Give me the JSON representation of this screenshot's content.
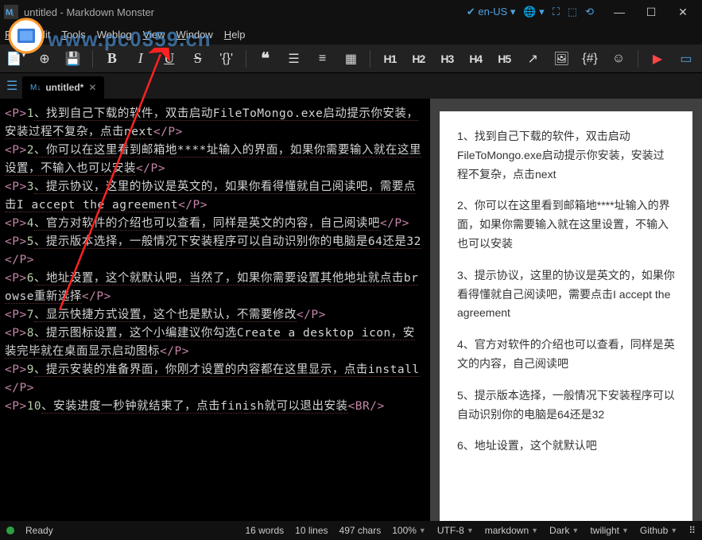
{
  "title": "untitled  - Markdown Monster",
  "lang": "en-US",
  "menu": [
    "File",
    "Edit",
    "Tools",
    "Weblog",
    "View",
    "Window",
    "Help"
  ],
  "toolbar_headings": [
    "H1",
    "H2",
    "H3",
    "H4",
    "H5"
  ],
  "tab": {
    "name": "untitled*",
    "icon": "⬇"
  },
  "editor_lines": [
    {
      "n": "1",
      "t": "、找到自己下载的软件，双击启动FileToMongo.exe启动提示你安装，安装过程不复杂，点击next"
    },
    {
      "n": "2",
      "t": "、你可以在这里看到邮箱地****址输入的界面，如果你需要输入就在这里设置，不输入也可以安装"
    },
    {
      "n": "3",
      "t": "、提示协议，这里的协议是英文的，如果你看得懂就自己阅读吧，需要点击I accept the agreement"
    },
    {
      "n": "4",
      "t": "、官方对软件的介绍也可以查看，同样是英文的内容，自己阅读吧"
    },
    {
      "n": "5",
      "t": "、提示版本选择，一般情况下安装程序可以自动识别你的电脑是64还是32"
    },
    {
      "n": "6",
      "t": "、地址设置，这个就默认吧，当然了，如果你需要设置其他地址就点击browse重新选择"
    },
    {
      "n": "7",
      "t": "、显示快捷方式设置，这个也是默认，不需要修改"
    },
    {
      "n": "8",
      "t": "、提示图标设置，这个小编建议你勾选Create a desktop icon，安装完毕就在桌面显示启动图标"
    },
    {
      "n": "9",
      "t": "、提示安装的准备界面，你刚才设置的内容都在这里显示，点击install"
    },
    {
      "n": "10",
      "t": "、安装进度一秒钟就结束了，点击finish就可以退出安装"
    }
  ],
  "preview_paras": [
    "1、找到自己下载的软件，双击启动FileToMongo.exe启动提示你安装，安装过程不复杂，点击next",
    "2、你可以在这里看到邮箱地****址输入的界面，如果你需要输入就在这里设置，不输入也可以安装",
    "3、提示协议，这里的协议是英文的，如果你看得懂就自己阅读吧，需要点击I accept the agreement",
    "4、官方对软件的介绍也可以查看，同样是英文的内容，自己阅读吧",
    "5、提示版本选择，一般情况下安装程序可以自动识别你的电脑是64还是32",
    "6、地址设置，这个就默认吧"
  ],
  "status": {
    "ready": "Ready",
    "words": "16 words",
    "lines": "10 lines",
    "chars": "497 chars",
    "zoom": "100%",
    "encoding": "UTF-8",
    "syntax": "markdown",
    "theme": "Dark",
    "scheme": "twilight",
    "git": "Github"
  },
  "watermark": "www.pc0359.cn"
}
